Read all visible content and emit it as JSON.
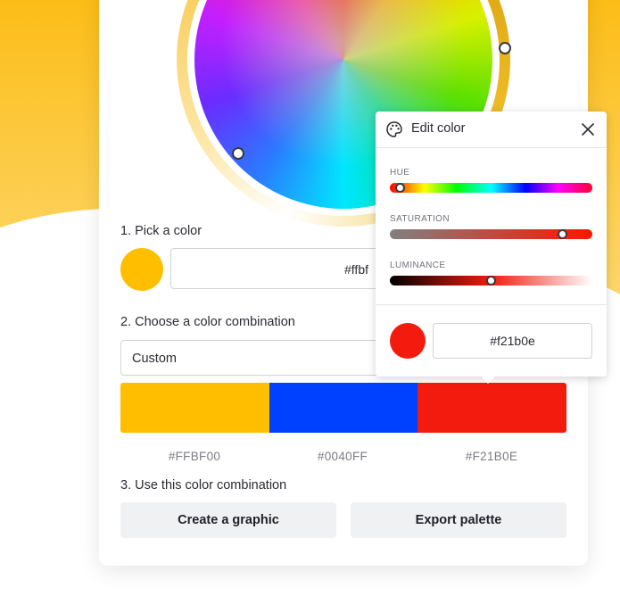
{
  "colors": {
    "picked": "#ffbf00",
    "palette": [
      "#ffbf00",
      "#0040ff",
      "#f21b0e"
    ],
    "edit": "#f21b0e"
  },
  "steps": {
    "pick_label": "1. Pick a color",
    "pick_hex": "#ffbf",
    "combo_label": "2. Choose a color combination",
    "combo_value": "Custom",
    "use_label": "3. Use this color combination"
  },
  "palette_hex": [
    "#FFBF00",
    "#0040FF",
    "#F21B0E"
  ],
  "buttons": {
    "create": "Create a graphic",
    "export": "Export palette"
  },
  "edit_popover": {
    "title": "Edit color",
    "hue_label": "HUE",
    "hue_level": 0.03,
    "saturation_label": "SATURATION",
    "saturation_level": 0.87,
    "luminance_label": "LUMINANCE",
    "luminance_level": 0.5,
    "hex_value": "#f21b0e"
  },
  "icons": [
    "palette-icon",
    "close-icon"
  ]
}
